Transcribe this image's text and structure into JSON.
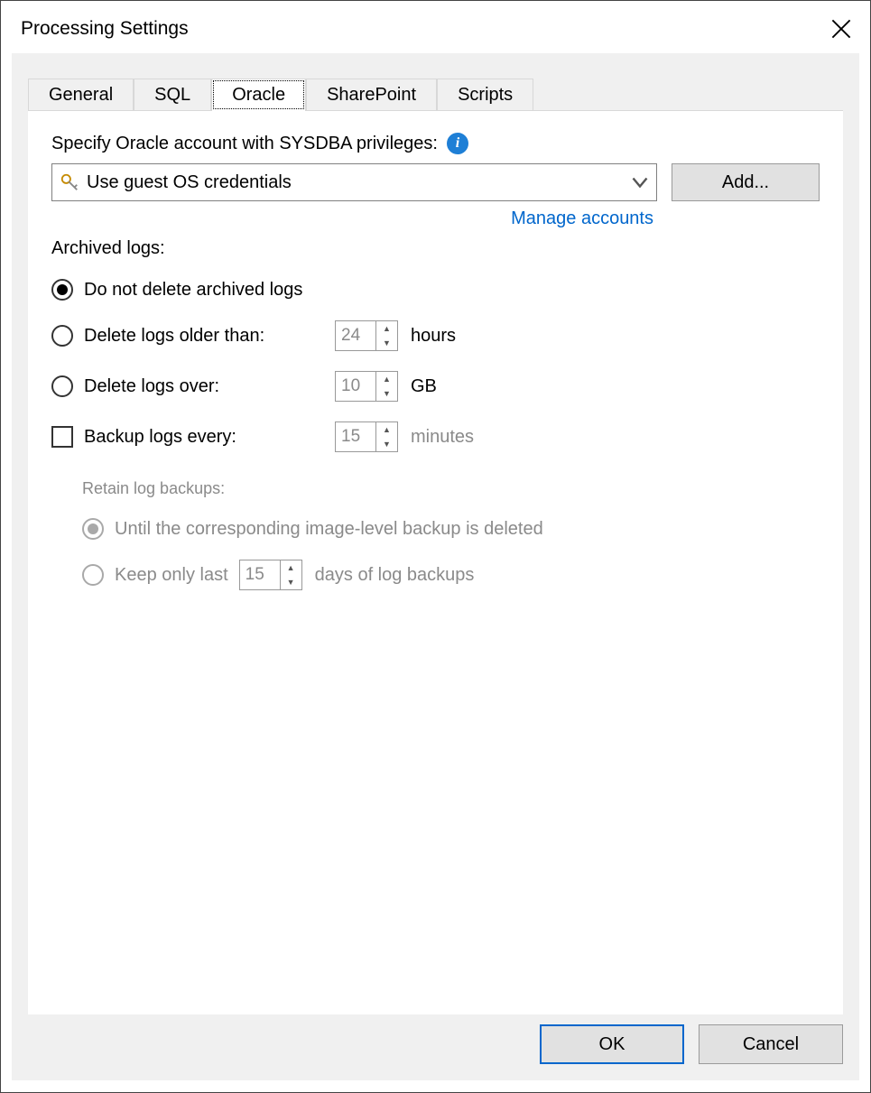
{
  "window": {
    "title": "Processing Settings"
  },
  "tabs": {
    "items": [
      {
        "label": "General"
      },
      {
        "label": "SQL"
      },
      {
        "label": "Oracle"
      },
      {
        "label": "SharePoint"
      },
      {
        "label": "Scripts"
      }
    ],
    "active_index": 2
  },
  "oracle": {
    "account_label": "Specify Oracle account with SYSDBA privileges:",
    "combo_value": "Use guest OS credentials",
    "add_button": "Add...",
    "manage_link": "Manage accounts",
    "archived_label": "Archived logs:",
    "opt_no_delete": "Do not delete archived logs",
    "opt_older": "Delete logs older than:",
    "opt_older_value": "24",
    "opt_older_unit": "hours",
    "opt_over": "Delete logs over:",
    "opt_over_value": "10",
    "opt_over_unit": "GB",
    "chk_backup_every": "Backup logs every:",
    "chk_backup_value": "15",
    "chk_backup_unit": "minutes",
    "retain_label": "Retain log backups:",
    "retain_until": "Until the corresponding image-level backup is deleted",
    "retain_keep_prefix": "Keep only last",
    "retain_keep_value": "15",
    "retain_keep_suffix": "days of log backups"
  },
  "footer": {
    "ok": "OK",
    "cancel": "Cancel"
  }
}
